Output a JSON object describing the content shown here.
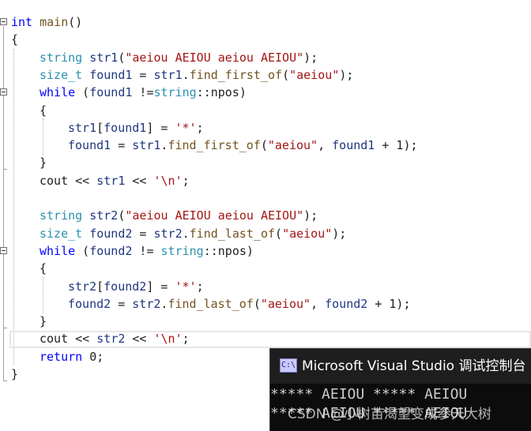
{
  "editor": {
    "lines": [
      {
        "segs": [
          {
            "c": "kw",
            "t": "int"
          },
          {
            "c": "",
            "t": " "
          },
          {
            "c": "fn",
            "t": "main"
          },
          {
            "c": "",
            "t": "()"
          }
        ]
      },
      {
        "segs": [
          {
            "c": "",
            "t": "{"
          }
        ]
      },
      {
        "segs": [
          {
            "c": "ty",
            "t": "string"
          },
          {
            "c": "",
            "t": " "
          },
          {
            "c": "id",
            "t": "str1"
          },
          {
            "c": "",
            "t": "("
          },
          {
            "c": "st",
            "t": "\"aeiou AEIOU aeiou AEIOU\""
          },
          {
            "c": "",
            "t": ");"
          }
        ]
      },
      {
        "segs": [
          {
            "c": "ty",
            "t": "size_t"
          },
          {
            "c": "",
            "t": " "
          },
          {
            "c": "id",
            "t": "found1"
          },
          {
            "c": "",
            "t": " = "
          },
          {
            "c": "id",
            "t": "str1"
          },
          {
            "c": "",
            "t": "."
          },
          {
            "c": "fn",
            "t": "find_first_of"
          },
          {
            "c": "",
            "t": "("
          },
          {
            "c": "st",
            "t": "\"aeiou\""
          },
          {
            "c": "",
            "t": ");"
          }
        ]
      },
      {
        "segs": [
          {
            "c": "kw",
            "t": "while"
          },
          {
            "c": "",
            "t": " ("
          },
          {
            "c": "id",
            "t": "found1"
          },
          {
            "c": "",
            "t": " !="
          },
          {
            "c": "ty",
            "t": "string"
          },
          {
            "c": "",
            "t": "::"
          },
          {
            "c": "",
            "t": "npos)"
          }
        ]
      },
      {
        "segs": [
          {
            "c": "",
            "t": "{"
          }
        ]
      },
      {
        "segs": [
          {
            "c": "id",
            "t": "str1"
          },
          {
            "c": "",
            "t": "["
          },
          {
            "c": "id",
            "t": "found1"
          },
          {
            "c": "",
            "t": "] = "
          },
          {
            "c": "st",
            "t": "'*'"
          },
          {
            "c": "",
            "t": ";"
          }
        ]
      },
      {
        "segs": [
          {
            "c": "id",
            "t": "found1"
          },
          {
            "c": "",
            "t": " = "
          },
          {
            "c": "id",
            "t": "str1"
          },
          {
            "c": "",
            "t": "."
          },
          {
            "c": "fn",
            "t": "find_first_of"
          },
          {
            "c": "",
            "t": "("
          },
          {
            "c": "st",
            "t": "\"aeiou\""
          },
          {
            "c": "",
            "t": ", "
          },
          {
            "c": "id",
            "t": "found1"
          },
          {
            "c": "",
            "t": " + 1);"
          }
        ]
      },
      {
        "segs": [
          {
            "c": "",
            "t": "}"
          }
        ]
      },
      {
        "segs": [
          {
            "c": "",
            "t": "cout << "
          },
          {
            "c": "id",
            "t": "str1"
          },
          {
            "c": "",
            "t": " << "
          },
          {
            "c": "st",
            "t": "'\\n'"
          },
          {
            "c": "",
            "t": ";"
          }
        ]
      },
      {
        "segs": []
      },
      {
        "segs": [
          {
            "c": "ty",
            "t": "string"
          },
          {
            "c": "",
            "t": " "
          },
          {
            "c": "id",
            "t": "str2"
          },
          {
            "c": "",
            "t": "("
          },
          {
            "c": "st",
            "t": "\"aeiou AEIOU aeiou AEIOU\""
          },
          {
            "c": "",
            "t": ");"
          }
        ]
      },
      {
        "segs": [
          {
            "c": "ty",
            "t": "size_t"
          },
          {
            "c": "",
            "t": " "
          },
          {
            "c": "id",
            "t": "found2"
          },
          {
            "c": "",
            "t": " = "
          },
          {
            "c": "id",
            "t": "str2"
          },
          {
            "c": "",
            "t": "."
          },
          {
            "c": "fn",
            "t": "find_last_of"
          },
          {
            "c": "",
            "t": "("
          },
          {
            "c": "st",
            "t": "\"aeiou\""
          },
          {
            "c": "",
            "t": ");"
          }
        ]
      },
      {
        "segs": [
          {
            "c": "kw",
            "t": "while"
          },
          {
            "c": "",
            "t": " ("
          },
          {
            "c": "id",
            "t": "found2"
          },
          {
            "c": "",
            "t": " != "
          },
          {
            "c": "ty",
            "t": "string"
          },
          {
            "c": "",
            "t": "::"
          },
          {
            "c": "",
            "t": "npos)"
          }
        ]
      },
      {
        "segs": [
          {
            "c": "",
            "t": "{"
          }
        ]
      },
      {
        "segs": [
          {
            "c": "id",
            "t": "str2"
          },
          {
            "c": "",
            "t": "["
          },
          {
            "c": "id",
            "t": "found2"
          },
          {
            "c": "",
            "t": "] = "
          },
          {
            "c": "st",
            "t": "'*'"
          },
          {
            "c": "",
            "t": ";"
          }
        ]
      },
      {
        "segs": [
          {
            "c": "id",
            "t": "found2"
          },
          {
            "c": "",
            "t": " = "
          },
          {
            "c": "id",
            "t": "str2"
          },
          {
            "c": "",
            "t": "."
          },
          {
            "c": "fn",
            "t": "find_last_of"
          },
          {
            "c": "",
            "t": "("
          },
          {
            "c": "st",
            "t": "\"aeiou\""
          },
          {
            "c": "",
            "t": ", "
          },
          {
            "c": "id",
            "t": "found2"
          },
          {
            "c": "",
            "t": " + 1);"
          }
        ]
      },
      {
        "segs": [
          {
            "c": "",
            "t": "}"
          }
        ]
      },
      {
        "segs": [
          {
            "c": "",
            "t": "cout << "
          },
          {
            "c": "id",
            "t": "str2"
          },
          {
            "c": "",
            "t": " << "
          },
          {
            "c": "st",
            "t": "'\\n'"
          },
          {
            "c": "",
            "t": ";"
          }
        ]
      },
      {
        "segs": [
          {
            "c": "kw",
            "t": "return"
          },
          {
            "c": "",
            "t": " 0;"
          }
        ]
      },
      {
        "segs": [
          {
            "c": "",
            "t": "}"
          }
        ]
      }
    ]
  },
  "console": {
    "icon_text": "C:\\",
    "title": "Microsoft Visual Studio 调试控制台",
    "output": [
      "***** AEIOU ***** AEIOU",
      "***** AEIOU ***** AEIOU"
    ]
  },
  "watermark": "CSDN @小树苗渴望变成参天大树",
  "colors": {
    "keyword": "#0000ff",
    "type": "#2b91af",
    "identifier": "#1f377f",
    "string": "#a31515",
    "function": "#74531f",
    "console_bg": "#0c0c0c"
  }
}
